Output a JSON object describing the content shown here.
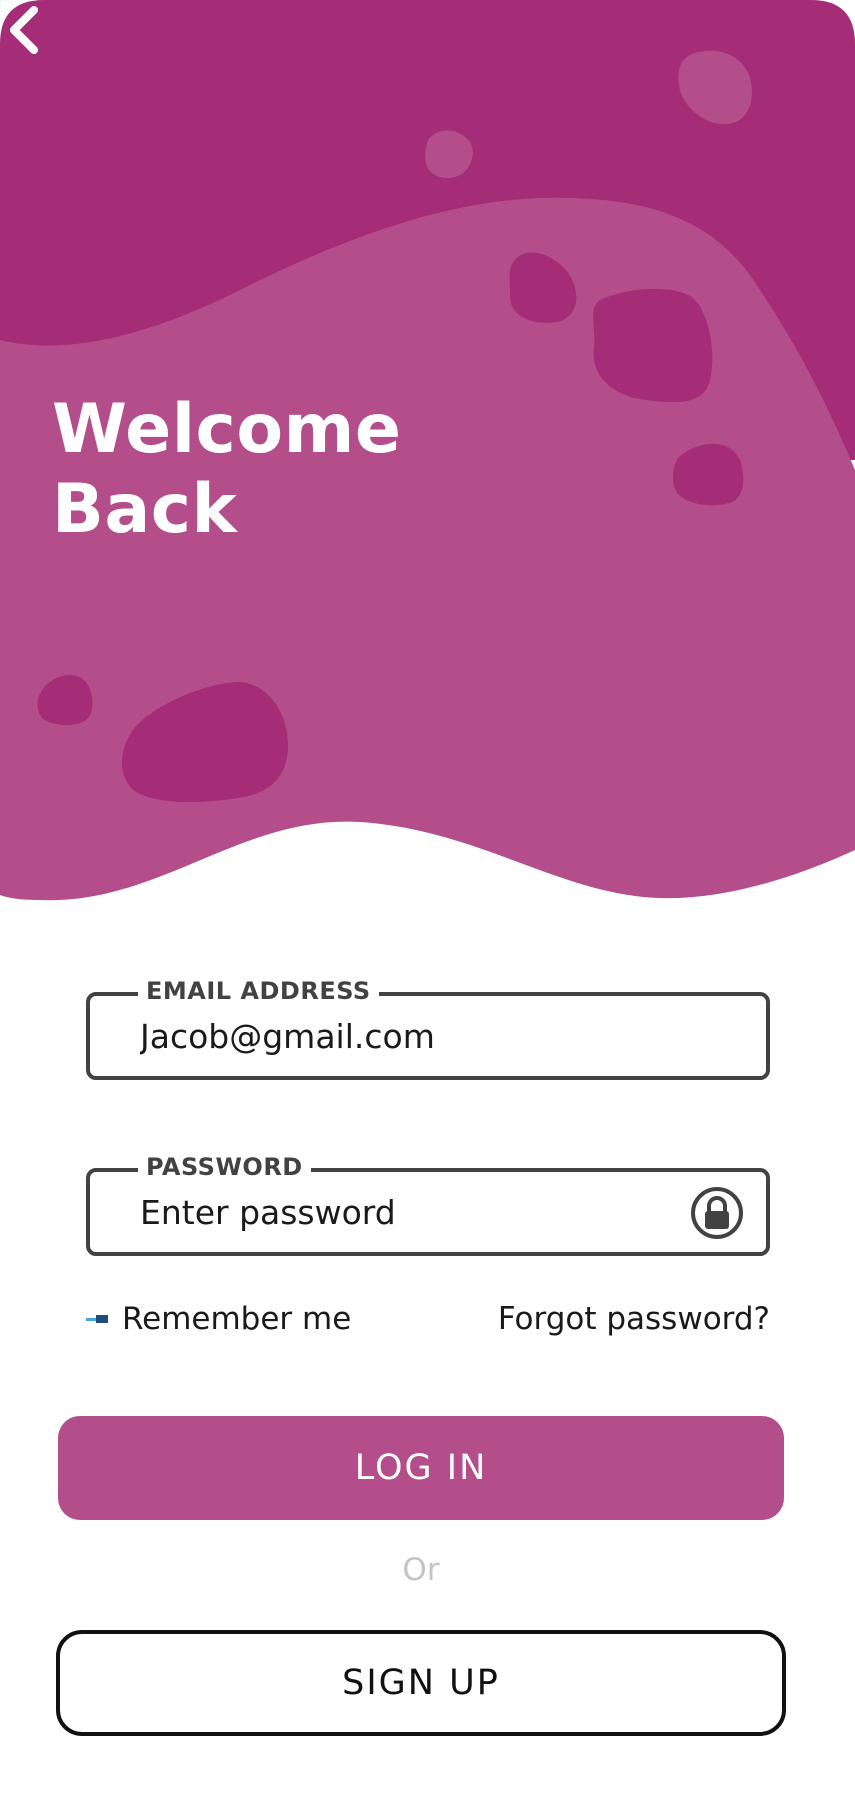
{
  "header": {
    "title_line1": "Welcome",
    "title_line2": "Back",
    "back_icon": "chevron-left-icon"
  },
  "form": {
    "email": {
      "label": "EMAIL ADDRESS",
      "value": "Jacob@gmail.com"
    },
    "password": {
      "label": "PASSWORD",
      "placeholder": "Enter password",
      "icon": "lock-icon"
    },
    "remember_label": "Remember me",
    "forgot_label": "Forgot password?"
  },
  "actions": {
    "login_label": "LOG IN",
    "or_label": "Or",
    "signup_label": "SIGN UP"
  },
  "colors": {
    "primary": "#b34e8a",
    "primary_dark": "#a52c76",
    "border": "#424242",
    "muted": "#c4c4c4"
  }
}
